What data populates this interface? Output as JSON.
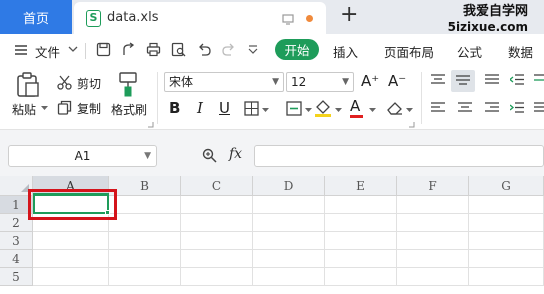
{
  "tabbar": {
    "home_label": "首页",
    "doc_tab": {
      "name": "data.xls",
      "icon": "xls-file-icon",
      "icon_letter": "S"
    },
    "new_tab_label": "+",
    "brand_line1": "我爱自学网",
    "brand_line2": "5izixue.com"
  },
  "menubar": {
    "file_label": "文件",
    "items": [
      "开始",
      "插入",
      "页面布局",
      "公式",
      "数据"
    ],
    "active_item": "开始",
    "quick_icons": [
      "save-icon",
      "export-icon",
      "print-icon",
      "print-preview-icon",
      "undo-icon",
      "redo-icon",
      "customize-dropdown-icon"
    ]
  },
  "ribbon": {
    "paste_label": "粘贴",
    "cut_label": "剪切",
    "copy_label": "复制",
    "format_painter_label": "格式刷",
    "font_name": "宋体",
    "font_size": "12",
    "increase_font_label": "A⁺",
    "decrease_font_label": "A⁻",
    "bold_label": "B",
    "italic_label": "I",
    "underline_label": "U",
    "font_color_label": "A",
    "accent_colors": {
      "highlight": "#f5d31b",
      "font_color": "#e02020"
    }
  },
  "formula_bar": {
    "cell_ref": "A1",
    "fx_label": "fx",
    "formula_value": ""
  },
  "sheet": {
    "columns": [
      "A",
      "B",
      "C",
      "D",
      "E",
      "F",
      "G"
    ],
    "rows": [
      "1",
      "2",
      "3",
      "4",
      "5"
    ],
    "selected_cell": "A1"
  },
  "colors": {
    "home_tab": "#2f7ae5",
    "accent_green": "#1e9c5a",
    "annotation_red": "#d4141b"
  }
}
